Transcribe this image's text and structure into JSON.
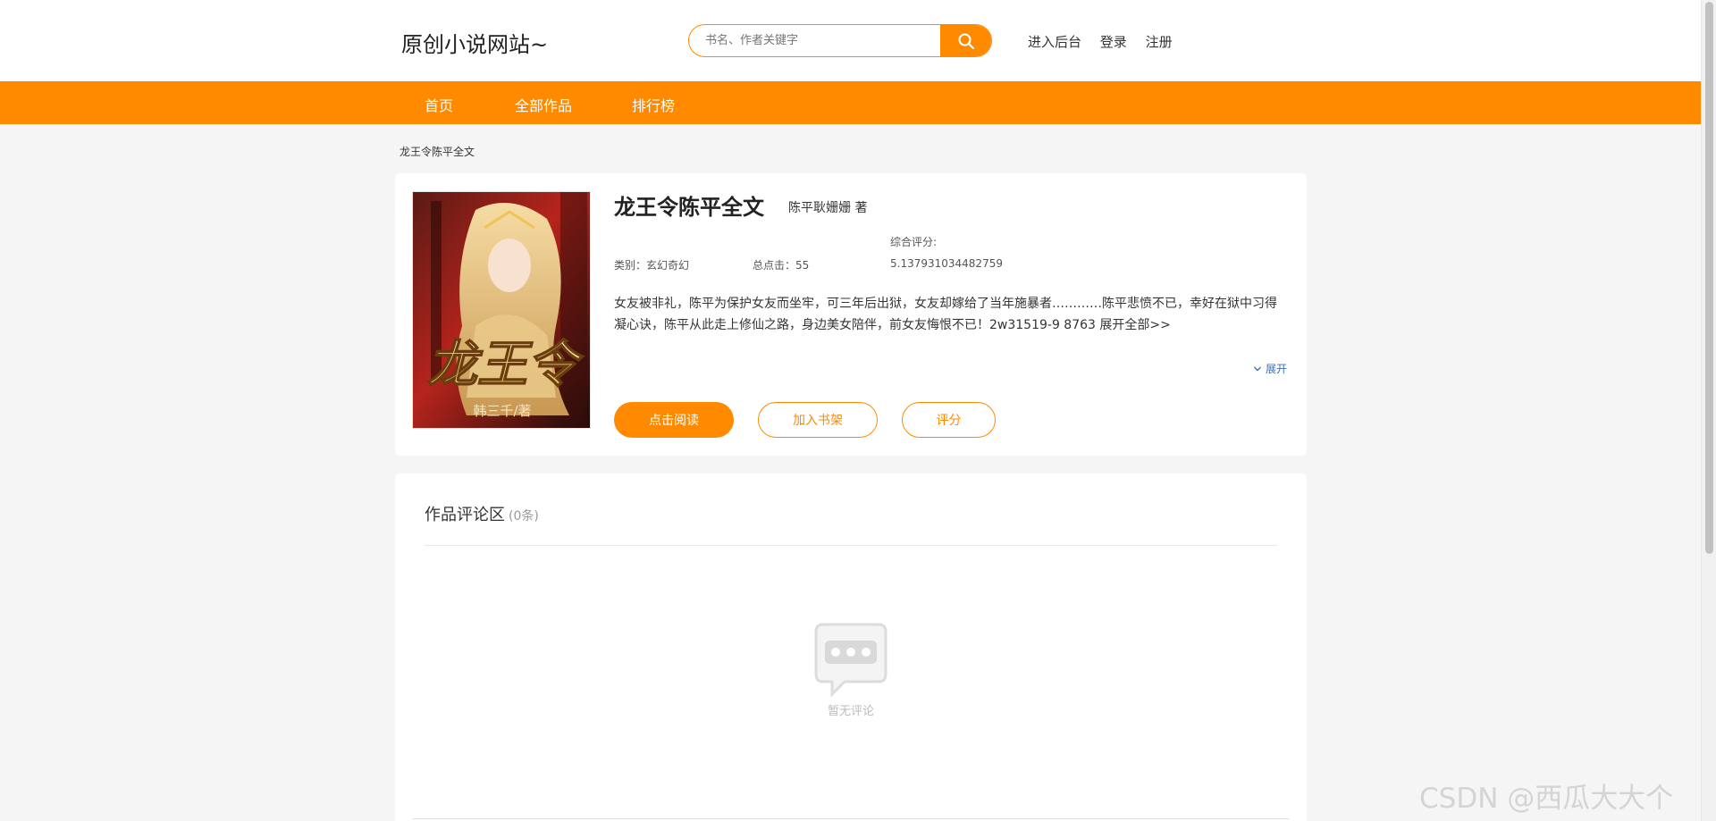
{
  "header": {
    "logo": "原创小说网站~",
    "search_placeholder": "书名、作者关键字",
    "links": [
      "进入后台",
      "登录",
      "注册"
    ]
  },
  "nav": [
    "首页",
    "全部作品",
    "排行榜"
  ],
  "breadcrumb": "龙王令陈平全文",
  "book": {
    "title": "龙王令陈平全文",
    "author": "陈平耿姗姗 著",
    "score_label": "综合评分:",
    "category": "类别：玄幻奇幻",
    "clicks": "总点击：55",
    "score_value": "5.137931034482759",
    "description": "女友被非礼，陈平为保护女友而坐牢，可三年后出狱，女友却嫁给了当年施暴者…………陈平悲愤不已，幸好在狱中习得凝心诀，陈平从此走上修仙之路，身边美女陪伴，前女友悔恨不已！2w31519-9 8763 展开全部>>",
    "expand": "展开",
    "cover_title": "龙王令",
    "cover_author": "韩三千/著",
    "buttons": {
      "read": "点击阅读",
      "shelf": "加入书架",
      "rate": "评分"
    }
  },
  "comments": {
    "title": "作品评论区",
    "count": "(0条)",
    "empty": "暂无评论"
  },
  "watermark": "CSDN @西瓜大大个",
  "colors": {
    "accent": "#ff8a00",
    "link_blue": "#3d6fb5"
  }
}
